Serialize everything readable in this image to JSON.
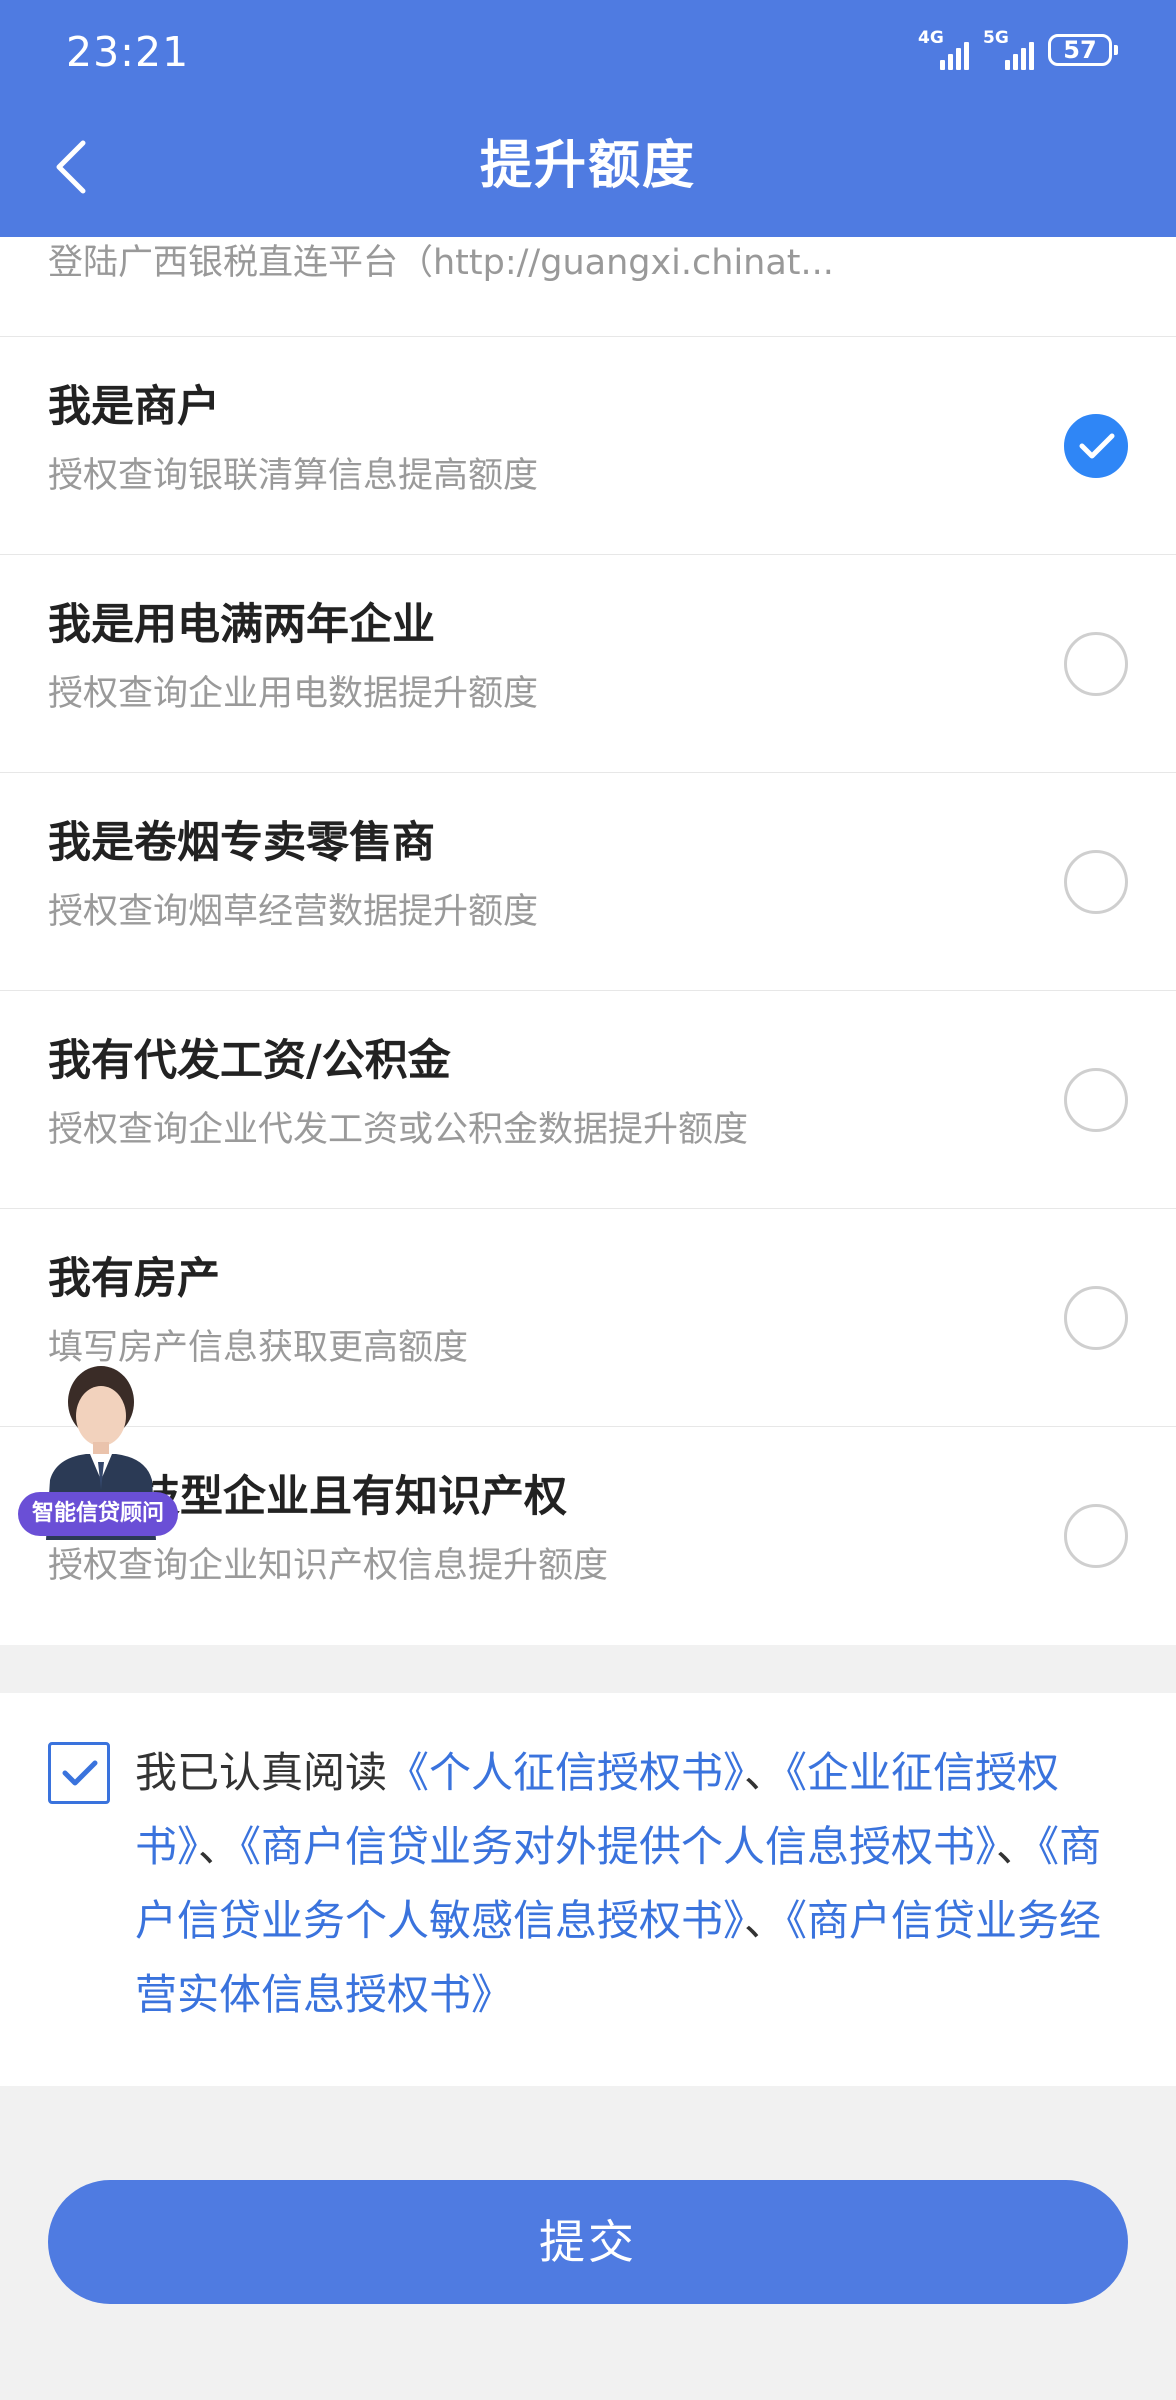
{
  "status_bar": {
    "time": "23:21",
    "signal_1_label": "4G",
    "signal_2_label": "5G",
    "battery": "57"
  },
  "header": {
    "title": "提升额度"
  },
  "list": {
    "clipped_subtitle": "登陆广西银税直连平台（http://guangxi.chinat...",
    "items": [
      {
        "title": "我是商户",
        "subtitle": "授权查询银联清算信息提高额度",
        "selected": true
      },
      {
        "title": "我是用电满两年企业",
        "subtitle": "授权查询企业用电数据提升额度",
        "selected": false
      },
      {
        "title": "我是卷烟专卖零售商",
        "subtitle": "授权查询烟草经营数据提升额度",
        "selected": false
      },
      {
        "title": "我有代发工资/公积金",
        "subtitle": "授权查询企业代发工资或公积金数据提升额度",
        "selected": false
      },
      {
        "title": "我有房产",
        "subtitle": "填写房产信息获取更高额度",
        "selected": false
      },
      {
        "title": "科技型企业且有知识产权",
        "subtitle": "授权查询企业知识产权信息提升额度",
        "selected": false
      }
    ]
  },
  "advisor": {
    "badge": "智能信贷顾问"
  },
  "agreement": {
    "checked": true,
    "prefix": "我已认真阅读",
    "link_1": "《个人征信授权书》",
    "sep_1": "、",
    "link_2": "《企业征信授权书》",
    "sep_2": "、",
    "link_3": "《商户信贷业务对外提供个人信息授权书》",
    "sep_3": "、",
    "link_4": "《商户信贷业务个人敏感信息授权书》",
    "sep_4": "、",
    "link_5": "《商户信贷业务经营实体信息授权书》"
  },
  "submit": {
    "label": "提交"
  },
  "colors": {
    "primary": "#4f7be1",
    "radio_checked": "#2f86f6",
    "link": "#3a73dd"
  }
}
